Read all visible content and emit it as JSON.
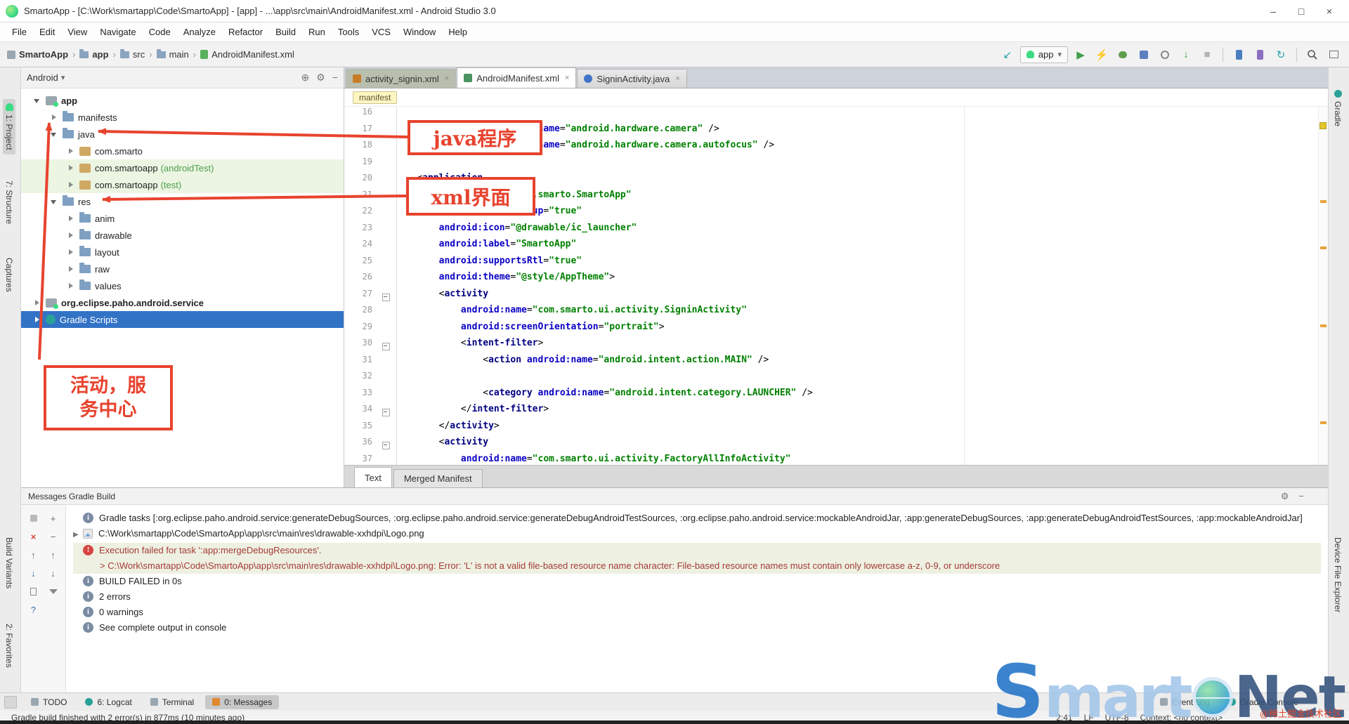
{
  "window": {
    "title": "SmartoApp - [C:\\Work\\smartapp\\Code\\SmartoApp] - [app] - ...\\app\\src\\main\\AndroidManifest.xml - Android Studio 3.0"
  },
  "icons": {
    "minimize": "–",
    "maximize": "□",
    "close": "×",
    "caret_down": "▾",
    "breadcrumb_sep": "›",
    "run": "▶",
    "stop": "■",
    "lightning": "⚡",
    "attach_arrow": "↙",
    "sync": "↻",
    "gear": "⚙",
    "collapse": "−",
    "expand_plus": "+",
    "up": "↑",
    "down": "↓",
    "help": "?",
    "info": "i",
    "error": "!",
    "locate": "⊕"
  },
  "menu_bar": {
    "items": [
      "File",
      "Edit",
      "View",
      "Navigate",
      "Code",
      "Analyze",
      "Refactor",
      "Build",
      "Run",
      "Tools",
      "VCS",
      "Window",
      "Help"
    ]
  },
  "nav_bar": {
    "breadcrumbs": [
      "SmartoApp",
      "app",
      "src",
      "main",
      "AndroidManifest.xml"
    ],
    "run_config": "app"
  },
  "left_stripe": {
    "items": [
      "1: Project",
      "7: Structure",
      "Captures",
      "Build Variants",
      "2: Favorites"
    ]
  },
  "right_stripe": {
    "items": [
      "Gradle",
      "Device File Explorer"
    ]
  },
  "project_panel": {
    "view_selector": "Android",
    "tree": [
      {
        "label": "app"
      },
      {
        "label": "manifests"
      },
      {
        "label": "java"
      },
      {
        "label": "com.smarto"
      },
      {
        "label": "com.smartoapp",
        "suffix": " (androidTest)"
      },
      {
        "label": "com.smartoapp",
        "suffix": " (test)"
      },
      {
        "label": "res"
      },
      {
        "label": "anim"
      },
      {
        "label": "drawable"
      },
      {
        "label": "layout"
      },
      {
        "label": "raw"
      },
      {
        "label": "values"
      },
      {
        "label": "org.eclipse.paho.android.service"
      },
      {
        "label": "Gradle Scripts"
      }
    ]
  },
  "editor": {
    "tabs": [
      {
        "label": "activity_signin.xml"
      },
      {
        "label": "AndroidManifest.xml"
      },
      {
        "label": "SigninActivity.java"
      }
    ],
    "breadcrumb_chip": "manifest",
    "line_numbers": [
      "16",
      "17",
      "18",
      "19",
      "20",
      "21",
      "22",
      "23",
      "24",
      "25",
      "26",
      "27",
      "28",
      "29",
      "30",
      "31",
      "32",
      "33",
      "34",
      "35",
      "36",
      "37"
    ],
    "lines": [
      "",
      "    <uses-feature android:name=\"android.hardware.camera\" />",
      "    <uses-feature android:name=\"android.hardware.camera.autofocus\" />",
      "",
      "    <application",
      "        android:name=\"com.smarto.SmartoApp\"",
      "        android:allowBackup=\"true\"",
      "        android:icon=\"@drawable/ic_launcher\"",
      "        android:label=\"SmartoApp\"",
      "        android:supportsRtl=\"true\"",
      "        android:theme=\"@style/AppTheme\">",
      "        <activity",
      "            android:name=\"com.smarto.ui.activity.SigninActivity\"",
      "            android:screenOrientation=\"portrait\">",
      "            <intent-filter>",
      "                <action android:name=\"android.intent.action.MAIN\" />",
      "",
      "                <category android:name=\"android.intent.category.LAUNCHER\" />",
      "            </intent-filter>",
      "        </activity>",
      "        <activity",
      "            android:name=\"com.smarto.ui.activity.FactoryAllInfoActivity\""
    ],
    "bottom_tabs": [
      "Text",
      "Merged Manifest"
    ]
  },
  "annotations": {
    "box1": "java程序",
    "box2": "xml界面",
    "box3_line1": "活动，服",
    "box3_line2": "务中心"
  },
  "messages_panel": {
    "title": "Messages Gradle Build",
    "rows": [
      {
        "text": "Gradle tasks [:org.eclipse.paho.android.service:generateDebugSources, :org.eclipse.paho.android.service:generateDebugAndroidTestSources, :org.eclipse.paho.android.service:mockableAndroidJar, :app:generateDebugSources, :app:generateDebugAndroidTestSources, :app:mockableAndroidJar]"
      },
      {
        "text": "C:\\Work\\smartapp\\Code\\SmartoApp\\app\\src\\main\\res\\drawable-xxhdpi\\Logo.png"
      },
      {
        "text": "Execution failed for task ':app:mergeDebugResources'."
      },
      {
        "text": "> C:\\Work\\smartapp\\Code\\SmartoApp\\app\\src\\main\\res\\drawable-xxhdpi\\Logo.png: Error: 'L' is not a valid file-based resource name character: File-based resource names must contain only lowercase a-z, 0-9, or underscore"
      },
      {
        "text": "BUILD FAILED in 0s"
      },
      {
        "text": "2 errors"
      },
      {
        "text": "0 warnings"
      },
      {
        "text": "See complete output in console"
      }
    ]
  },
  "bottom_bar": {
    "left": [
      "TODO",
      "6: Logcat",
      "Terminal",
      "0: Messages"
    ],
    "right": [
      "Event Log",
      "Gradle Console"
    ]
  },
  "status_bar": {
    "message": "Gradle build finished with 2 error(s) in 877ms (10 minutes ago)",
    "position": "2:41",
    "line_separator": "LF",
    "encoding": "UTF-8",
    "context": "Context: <no context>"
  },
  "watermark": {
    "part_s": "S",
    "part_mart": "mart",
    "part_net": "Net",
    "community": "@稀土掘金技术社区"
  }
}
